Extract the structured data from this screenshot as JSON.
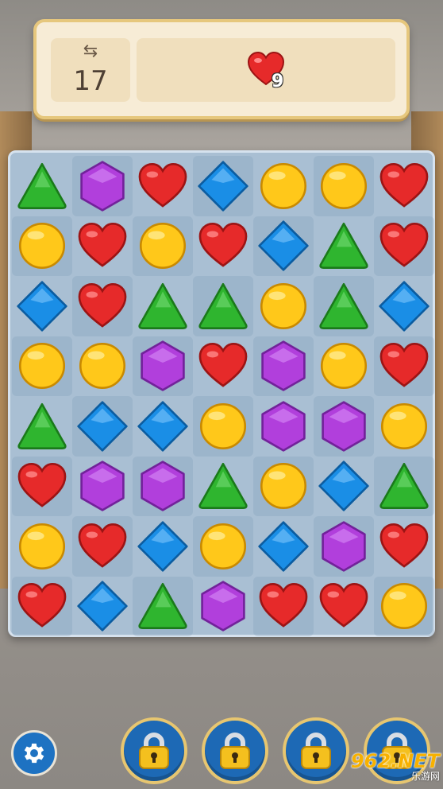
{
  "hud": {
    "moves_icon": "⇆",
    "moves_left": "17",
    "goal": {
      "gem": "heart",
      "remaining": "9"
    }
  },
  "board": {
    "rows": 8,
    "cols": 7,
    "gems": [
      [
        "triangle",
        "hexagon",
        "heart",
        "diamond",
        "circle",
        "circle",
        "heart"
      ],
      [
        "circle",
        "heart",
        "circle",
        "heart",
        "diamond",
        "triangle",
        "heart"
      ],
      [
        "diamond",
        "heart",
        "triangle",
        "triangle",
        "circle",
        "triangle",
        "diamond"
      ],
      [
        "circle",
        "circle",
        "hexagon",
        "heart",
        "hexagon",
        "circle",
        "heart"
      ],
      [
        "triangle",
        "diamond",
        "diamond",
        "circle",
        "hexagon",
        "hexagon",
        "circle"
      ],
      [
        "heart",
        "hexagon",
        "hexagon",
        "triangle",
        "circle",
        "diamond",
        "triangle"
      ],
      [
        "circle",
        "heart",
        "diamond",
        "circle",
        "diamond",
        "hexagon",
        "heart"
      ],
      [
        "heart",
        "diamond",
        "triangle",
        "hexagon",
        "heart",
        "heart",
        "circle"
      ]
    ]
  },
  "gem_colors": {
    "heart": "#e62a2a",
    "circle": "#ffc81a",
    "triangle": "#2fb52f",
    "diamond": "#1a8ee6",
    "hexagon": "#b13fdc"
  },
  "bottom_bar": {
    "settings_icon": "gear-icon",
    "boosters": [
      {
        "name": "booster-1",
        "state": "locked",
        "icon": "padlock-icon"
      },
      {
        "name": "booster-2",
        "state": "locked",
        "icon": "padlock-icon"
      },
      {
        "name": "booster-3",
        "state": "locked",
        "icon": "padlock-icon"
      },
      {
        "name": "booster-4",
        "state": "locked",
        "icon": "padlock-icon"
      }
    ]
  },
  "watermark": {
    "main": "962.NET",
    "sub": "乐游网"
  }
}
